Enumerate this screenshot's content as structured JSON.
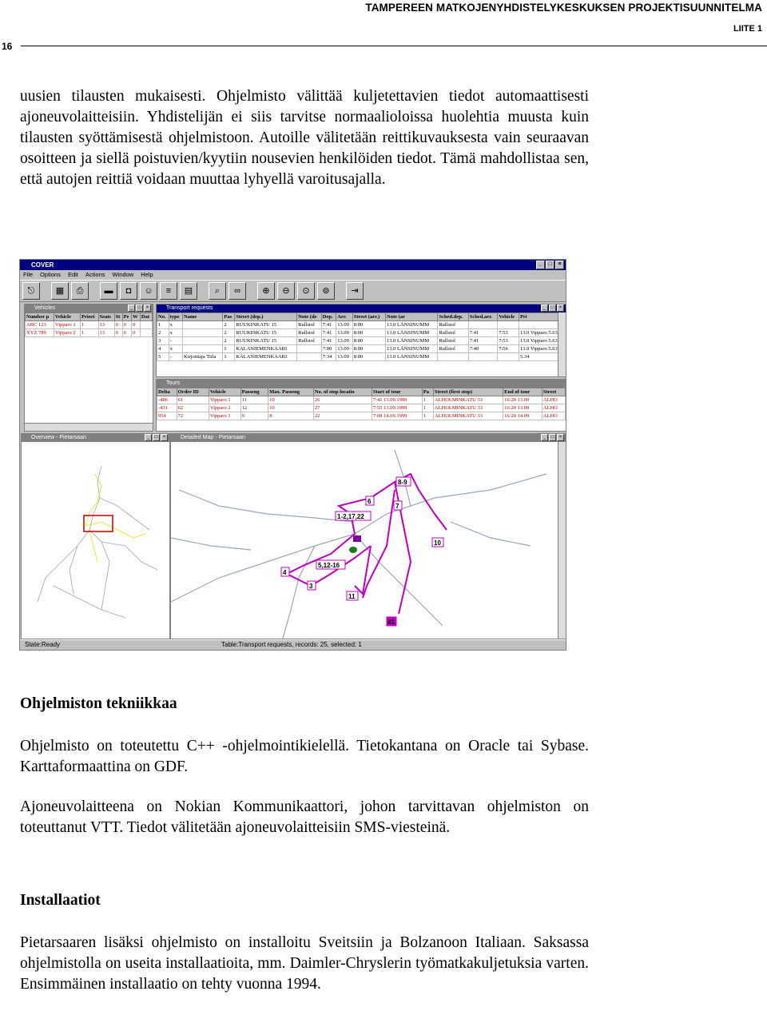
{
  "header": {
    "title": "TAMPEREEN MATKOJENYHDISTELYKESKUKSEN PROJEKTISUUNNITELMA",
    "page_number": "16",
    "appendix": "LIITE 1"
  },
  "intro_paragraph": "uusien tilausten mukaisesti. Ohjelmisto välittää kuljetettavien tiedot automaattisesti ajoneuvolaitteisiin. Yhdistelijän ei siis tarvitse normaaliolois­sa huolehtia muusta kuin tilausten syöttämisestä ohjelmistoon. Autoille välitetään reittikuvauksesta vain seuraavan osoitteen ja siellä poistuvi­en/kyytiin nousevien henkilöiden tiedot. Tämä mahdollistaa sen, että autojen reittiä voidaan muuttaa lyhyellä varoitusajalla.",
  "app": {
    "title": "COVER",
    "menu": [
      "File",
      "Options",
      "Edit",
      "Actions",
      "Window",
      "Help"
    ],
    "toolbar_icons": [
      "exit-icon",
      "table-icon",
      "printer-icon",
      "bus-icon",
      "taxi-icon",
      "people-icon",
      "list-icon",
      "form-icon",
      "vehicle-search-icon",
      "binoculars-icon",
      "zoom-in-icon",
      "zoom-out-icon",
      "zoom-all-icon",
      "zoom-fit-icon",
      "door-exit-icon"
    ],
    "vehicles": {
      "title": "Vehicles",
      "columns": [
        "Number p",
        "Vehicle",
        "Priori",
        "Seats",
        "St",
        "Pe",
        "W",
        "Dat"
      ],
      "rows": [
        [
          "ABC 123",
          "Vipparo 1",
          "1",
          "13",
          "0",
          "0",
          "0",
          ""
        ],
        [
          "XYZ 789",
          "Vipparo 2",
          "1",
          "13",
          "0",
          "0",
          "0",
          ""
        ]
      ]
    },
    "transport": {
      "title": "Transport requests",
      "columns": [
        "No.",
        "type",
        "Name",
        "Pas",
        "Street (dep.)",
        "Note (de",
        "Dep.",
        "Arr.",
        "Street (arr.)",
        "Note (ar",
        "Sched.dep.",
        "Sched.arr.",
        "Vehicle",
        "Pri"
      ],
      "rows": [
        [
          "1",
          "x",
          "",
          "2",
          "RUUKINKATU 15",
          "Rullstol",
          "7:41",
          "13.09",
          "8:00",
          "13.0 LÄNSINUMM",
          "Rullstol",
          "",
          "",
          "",
          ""
        ],
        [
          "2",
          "x",
          "",
          "2",
          "RUUKINKATU 15",
          "Rullstol",
          "7:41",
          "13.09",
          "8:00",
          "13.0 LÄNSINUMM",
          "Rullstol",
          "7:41",
          "13.09",
          "7:53",
          "13.0 Vipparo 5.63"
        ],
        [
          "3",
          "-",
          "",
          "2",
          "RUUKINKATU 15",
          "Rullstol",
          "7:41",
          "13.09",
          "8:00",
          "13.0 LÄNSINUMM",
          "Rullstol",
          "7:41",
          "13.09",
          "7:53",
          "13.0 Vipparo 5.63"
        ],
        [
          "4",
          "x",
          "",
          "1",
          "KALANIEMENKAARI",
          "",
          "7:00",
          "13.09",
          "8:00",
          "13.0 LÄNSINUMM",
          "Rullstol",
          "7:40",
          "14.09",
          "7:56",
          "13.0 Vipparo 5.63"
        ],
        [
          "5",
          "-",
          "Kirjoittaja Tiila",
          "1",
          "KALANIEMENKAARI",
          "",
          "7:34",
          "13.09",
          "8:00",
          "13.0 LÄNSINUMM",
          "",
          "",
          "",
          "",
          "5.34"
        ]
      ]
    },
    "tours": {
      "title": "Tours",
      "columns": [
        "Delta",
        "Order ID",
        "Vehicle",
        "Passeng",
        "Max. Passeng",
        "No. of stop locatio",
        "Start of tour",
        "Pa",
        "Street (first stop)",
        "End of tour",
        "Street"
      ],
      "rows": [
        [
          "-486",
          "61",
          "Vipparo 1",
          "11",
          "10",
          "26",
          "7:41 13.09.1999",
          "1",
          "ALHOLMINKATU 33",
          "16:20 13.09",
          "ALHO"
        ],
        [
          "-431",
          "62",
          "Vipparo 2",
          "12",
          "10",
          "27",
          "7:55 13.09.1999",
          "1",
          "ALHOLMINKATU 33",
          "16:20 13.09",
          "ALHO"
        ],
        [
          "954",
          "72",
          "Vipparo 1",
          "9",
          "8",
          "22",
          "7:08 14.09.1999",
          "1",
          "ALHOLMINKATU 33",
          "16:20 14.09",
          "ALHO"
        ]
      ]
    },
    "overview": {
      "title": "Overview - Pietarsaari"
    },
    "detailed_map": {
      "title": "Detailed Map - Pietarsaari",
      "labels": [
        "8-9",
        "6",
        "7",
        "1-2,17,22",
        "10",
        "5,12-16",
        "4",
        "3",
        "11",
        "41"
      ]
    },
    "status_left": "State:Ready",
    "status_right": "Table:Transport requests,  records: 25, selected: 1",
    "colors": {
      "titlebar": "#000080",
      "route": "#c000c0",
      "roads": "#9aa7b8",
      "vehicles_text": "#c00000"
    }
  },
  "section1": {
    "heading": "Ohjelmiston tekniikkaa",
    "p1": "Ohjelmisto on toteutettu C++ -ohjelmointikielellä. Tietokantana on Oracle tai Sybase. Karttaformaattina on GDF.",
    "p2": "Ajoneuvolaitteena on Nokian Kommunikaattori, johon tarvittavan oh­jelmiston on toteuttanut VTT. Tiedot välitetään ajoneuvolaitteisiin SMS-viesteinä."
  },
  "section2": {
    "heading": "Installaatiot",
    "p1": "Pietarsaaren lisäksi ohjelmisto on installoitu Sveitsiin ja Bolzanoon Itali­aan. Saksassa ohjelmistolla on useita installaatioita, mm. Daimler-Chryslerin työmatkakuljetuksia varten. Ensimmäinen installaatio on teh­ty vuonna 1994."
  }
}
